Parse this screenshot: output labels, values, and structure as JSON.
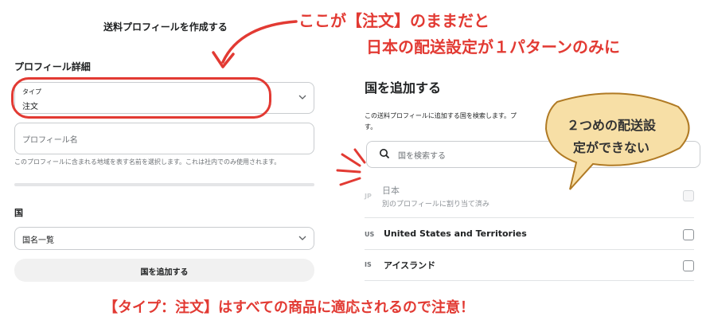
{
  "form": {
    "title": "送料プロフィールを作成する",
    "section_title": "プロフィール詳細",
    "type_label": "タイプ",
    "type_value": "注文",
    "profile_name_placeholder": "プロフィール名",
    "profile_help": "このプロフィールに含まれる地域を表す名前を選択します。これは社内でのみ使用されます。",
    "country_title": "国",
    "country_select_value": "国名一覧",
    "add_country_button": "国を追加する"
  },
  "add_country": {
    "title": "国を追加する",
    "description": "この送料プロフィールに追加する国を検索します。プ",
    "description_2": "す。",
    "search_placeholder": "国を検索する",
    "rows": [
      {
        "code": "JP",
        "name": "日本",
        "sub": "別のプロフィールに割り当て済み",
        "checked": false,
        "disabled": true
      },
      {
        "code": "US",
        "name": "United States and Territories",
        "checked": false
      },
      {
        "code": "IS",
        "name": "アイスランド",
        "checked": false
      }
    ]
  },
  "annotations": {
    "line1": "ここが【注文】のままだと",
    "line2": "日本の配送設定が１パターンのみに",
    "bubble_line1": "２つめの配送設",
    "bubble_line2": "定ができない",
    "bottom": "【タイプ：注文】はすべての商品に適応されるので注意！"
  },
  "colors": {
    "annotation_red": "#e23a33",
    "bubble_fill": "#f7dfa6",
    "bubble_stroke": "#b07a24"
  },
  "icons": {
    "search": "search-icon",
    "chevron": "chevron-down-icon"
  }
}
